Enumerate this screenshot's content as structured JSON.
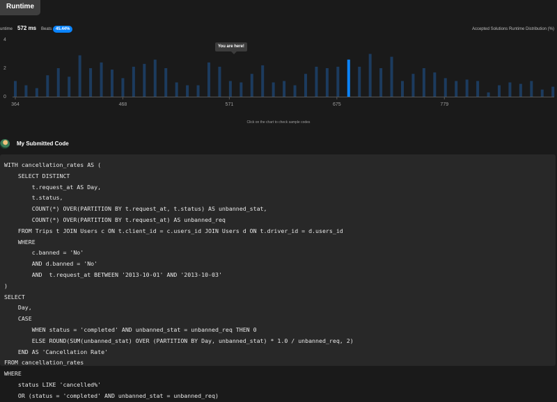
{
  "tab": {
    "label": "Runtime"
  },
  "stats": {
    "runtime_label": "untime",
    "runtime_value": "572 ms",
    "beats_label": "Beats",
    "beats_value": "45.44%",
    "distribution_title": "Accepted Solutions Runtime Distribution (%)"
  },
  "chart_data": {
    "type": "bar",
    "title": "Accepted Solutions Runtime Distribution (%)",
    "xlabel": "",
    "ylabel": "",
    "ylim": [
      0,
      4
    ],
    "yticks": [
      "4",
      "2",
      "0"
    ],
    "xticks": [
      {
        "label": "364",
        "value": 364
      },
      {
        "label": "468",
        "value": 468
      },
      {
        "label": "571",
        "value": 571
      },
      {
        "label": "675",
        "value": 675
      },
      {
        "label": "779",
        "value": 779
      }
    ],
    "x_start": 364,
    "x_step": 10.4,
    "highlight_index": 31,
    "values": [
      1.1,
      0.8,
      0.6,
      1.5,
      2.0,
      1.4,
      2.9,
      2.0,
      2.4,
      1.9,
      1.3,
      2.1,
      2.3,
      2.6,
      2.0,
      1.0,
      0.8,
      0.8,
      2.4,
      2.1,
      1.1,
      1.0,
      1.6,
      2.2,
      1.0,
      1.1,
      0.8,
      1.6,
      2.1,
      2.0,
      2.1,
      2.6,
      2.1,
      3.0,
      2.0,
      2.8,
      1.1,
      1.6,
      2.0,
      1.7,
      1.3,
      1.1,
      1.2,
      1.1,
      0.3,
      0.8,
      1.0,
      0.9,
      1.1,
      0.5,
      0.7,
      0.9,
      0.6,
      0.8,
      1.0,
      0.9,
      1.1,
      0.5,
      0.3,
      0.5,
      0.3,
      0.5,
      0.3,
      0.4,
      0.2,
      0.3,
      0.4,
      0.2,
      0.3,
      0.3,
      0.2,
      0.8,
      1.0,
      0.3,
      0.5,
      0.2,
      0.4,
      0.2,
      0.2,
      0.2,
      0.2,
      0.2,
      0.2
    ],
    "colors": {
      "bar": "#1c3b5e",
      "highlight": "#0a84ff",
      "axis": "#555555",
      "tick": "#9e9e9e"
    }
  },
  "tooltip": {
    "text": "You are here!"
  },
  "hint": {
    "text": "Click on the chart to check sample codes"
  },
  "submitted": {
    "title": "My Submitted Code"
  },
  "code": {
    "lines": [
      "WITH cancellation_rates AS (",
      "    SELECT DISTINCT",
      "        t.request_at AS Day,",
      "        t.status,",
      "        COUNT(*) OVER(PARTITION BY t.request_at, t.status) AS unbanned_stat,",
      "        COUNT(*) OVER(PARTITION BY t.request_at) AS unbanned_req",
      "    FROM Trips t JOIN Users c ON t.client_id = c.users_id JOIN Users d ON t.driver_id = d.users_id",
      "    WHERE",
      "        c.banned = 'No'",
      "        AND d.banned = 'No'",
      "        AND  t.request_at BETWEEN '2013-10-01' AND '2013-10-03'",
      ")",
      "SELECT",
      "    Day,",
      "    CASE",
      "        WHEN status = 'completed' AND unbanned_stat = unbanned_req THEN 0",
      "        ELSE ROUND(SUM(unbanned_stat) OVER (PARTITION BY Day, unbanned_stat) * 1.0 / unbanned_req, 2)",
      "    END AS 'Cancellation Rate'",
      "FROM cancellation_rates",
      "WHERE",
      "    status LIKE 'cancelled%'",
      "    OR (status = 'completed' AND unbanned_stat = unbanned_req)"
    ]
  }
}
